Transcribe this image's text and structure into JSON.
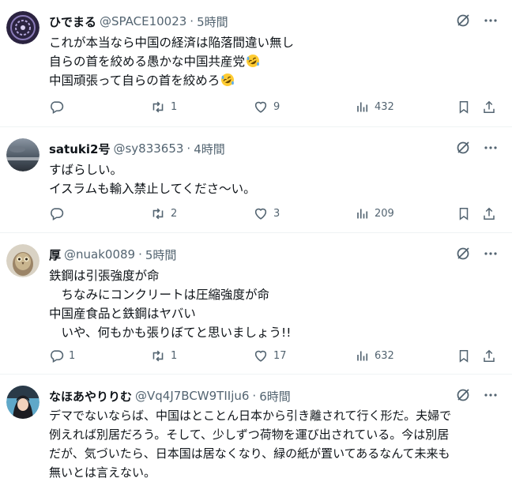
{
  "tweets": [
    {
      "name": "ひでまる",
      "handle": "@SPACE10023",
      "time": "5時間",
      "lines": [
        "これが本当なら中国の経済は陥落間違い無し",
        "自らの首を絞める愚かな中国共産党",
        "中国頑張って自らの首を絞めろ"
      ],
      "emoji": "rolling-on-floor-laughing",
      "replies": "",
      "reposts": "1",
      "likes": "9",
      "views": "432"
    },
    {
      "name": "satuki2号",
      "handle": "@sy833653",
      "time": "4時間",
      "lines": [
        "すばらしい。",
        "イスラムも輸入禁止してくださ〜い。"
      ],
      "replies": "",
      "reposts": "2",
      "likes": "3",
      "views": "209"
    },
    {
      "name": "厚",
      "handle": "@nuak0089",
      "time": "5時間",
      "lines": [
        "鉄鋼は引張強度が命",
        "　ちなみにコンクリートは圧縮強度が命",
        "中国産食品と鉄鋼はヤバい",
        "　いや、何もかも張りぼてと思いましょう!!"
      ],
      "replies": "1",
      "reposts": "1",
      "likes": "17",
      "views": "632"
    },
    {
      "name": "なほあやりりむ",
      "handle": "@Vq4J7BCW9TIIju6",
      "time": "6時間",
      "lines": [
        "デマでないならば、中国はとことん日本から引き離されて行く形だ。夫婦で",
        "例えれば別居だろう。そして、少しずつ荷物を運び出されている。今は別居",
        "だが、気づいたら、日本国は居なくなり、緑の紙が置いてあるなんて未来も",
        "無いとは言えない。"
      ]
    }
  ],
  "icons": {
    "grok": "grok-icon",
    "more": "more-icon",
    "reply": "reply-icon",
    "repost": "repost-icon",
    "like": "like-icon",
    "views": "views-icon",
    "bookmark": "bookmark-icon",
    "share": "share-icon"
  },
  "colors": {
    "text": "#0f1419",
    "secondary": "#536471",
    "divider": "#eff3f4"
  }
}
